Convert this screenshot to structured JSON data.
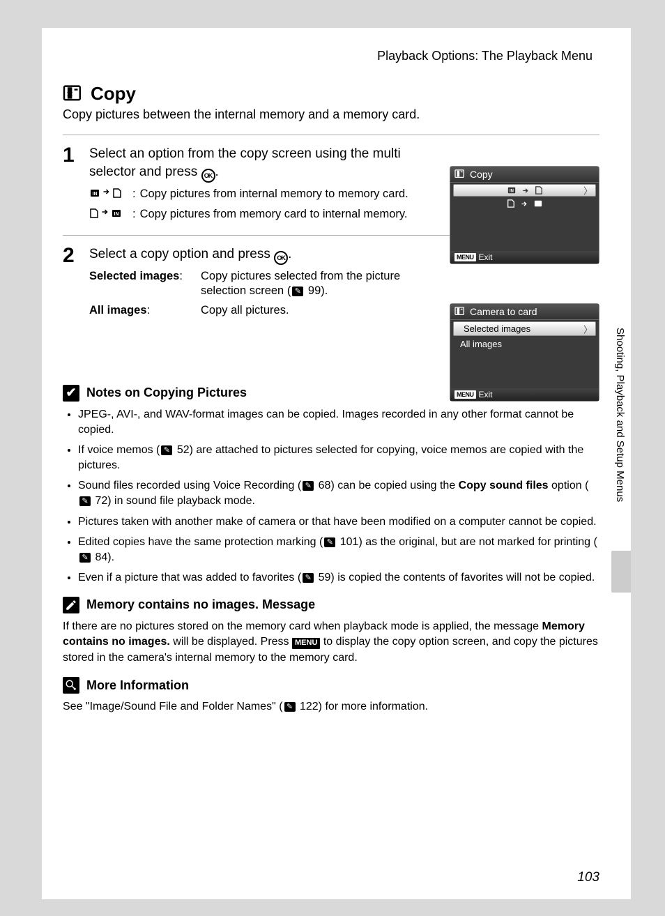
{
  "breadcrumb": "Playback Options: The Playback Menu",
  "title": "Copy",
  "intro": "Copy pictures between the internal memory and a memory card.",
  "steps": [
    {
      "num": "1",
      "title_a": "Select an option from the copy screen using the multi selector and press ",
      "title_b": ".",
      "subs": [
        {
          "desc": "Copy pictures from internal memory to memory card."
        },
        {
          "desc": "Copy pictures from memory card to internal memory."
        }
      ]
    },
    {
      "num": "2",
      "title_a": "Select a copy option and press ",
      "title_b": ".",
      "opts": [
        {
          "label": "Selected images",
          "desc_a": "Copy pictures selected from the picture selection screen (",
          "ref": "99",
          "desc_b": ")."
        },
        {
          "label": "All images",
          "desc": "Copy all pictures."
        }
      ]
    }
  ],
  "screens": {
    "scr1": {
      "title": "Copy",
      "exit": "Exit"
    },
    "scr2": {
      "title": "Camera to card",
      "item1": "Selected images",
      "item2": "All images",
      "exit": "Exit"
    }
  },
  "side_text": "Shooting, Playback and Setup Menus",
  "page_number": "103",
  "notes": {
    "n1_title": "Notes on Copying Pictures",
    "b1": "JPEG-, AVI-, and WAV-format images can be copied. Images recorded in any other format cannot be copied.",
    "b2_a": "If voice memos (",
    "b2_ref": "52",
    "b2_b": ") are attached to pictures selected for copying, voice memos are copied with the pictures.",
    "b3_a": "Sound files recorded using Voice Recording (",
    "b3_ref1": "68",
    "b3_b": ") can be copied using the ",
    "b3_bold": "Copy sound files",
    "b3_c": " option (",
    "b3_ref2": "72",
    "b3_d": ") in sound file playback mode.",
    "b4": "Pictures taken with another make of camera or that have been modified on a computer cannot be copied.",
    "b5_a": "Edited copies have the same protection marking (",
    "b5_ref1": "101",
    "b5_b": ") as the original, but are not marked for printing (",
    "b5_ref2": "84",
    "b5_c": ").",
    "b6_a": "Even if a picture that was added to favorites (",
    "b6_ref": "59",
    "b6_b": ") is copied the contents of favorites will not be copied.",
    "n2_title": "Memory contains no images. Message",
    "n2_para_a": "If there are no pictures stored on the memory card when playback mode is applied, the message ",
    "n2_bold": "Memory contains no images.",
    "n2_para_b": " will be displayed. Press ",
    "n2_menu": "MENU",
    "n2_para_c": " to display the copy option screen, and copy the pictures stored in the camera's internal memory to the memory card.",
    "n3_title": "More Information",
    "n3_para_a": "See \"Image/Sound File and Folder Names\" (",
    "n3_ref": "122",
    "n3_para_b": ") for more information."
  }
}
